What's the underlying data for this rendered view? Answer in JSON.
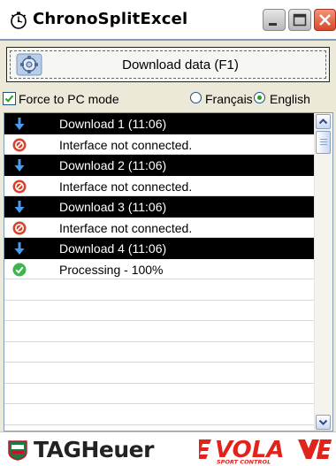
{
  "window": {
    "title": "ChronoSplitExcel"
  },
  "toolbar": {
    "download_label": "Download data (F1)"
  },
  "options": {
    "force_pc_label": "Force to PC mode",
    "force_pc_checked": true,
    "languages": [
      {
        "label": "Français",
        "selected": false
      },
      {
        "label": "English",
        "selected": true
      }
    ]
  },
  "list": {
    "rows": [
      {
        "type": "header",
        "icon": "download-arrow-icon",
        "text": "Download 1  (11:06)"
      },
      {
        "type": "item",
        "icon": "error-icon",
        "text": "Interface not connected."
      },
      {
        "type": "header",
        "icon": "download-arrow-icon",
        "text": "Download 2  (11:06)"
      },
      {
        "type": "item",
        "icon": "error-icon",
        "text": "Interface not connected."
      },
      {
        "type": "header",
        "icon": "download-arrow-icon",
        "text": "Download 3  (11:06)"
      },
      {
        "type": "item",
        "icon": "error-icon",
        "text": "Interface not connected."
      },
      {
        "type": "header",
        "icon": "download-arrow-icon",
        "text": "Download 4  (11:06)"
      },
      {
        "type": "item",
        "icon": "success-check-icon",
        "text": "Processing - 100%"
      }
    ]
  },
  "footer": {
    "brand": "TAGHeuer",
    "logo2": "VOLA"
  },
  "colors": {
    "accent": "#21a121",
    "error": "#d9412b",
    "download": "#2277dd",
    "header_bg": "#000000"
  }
}
